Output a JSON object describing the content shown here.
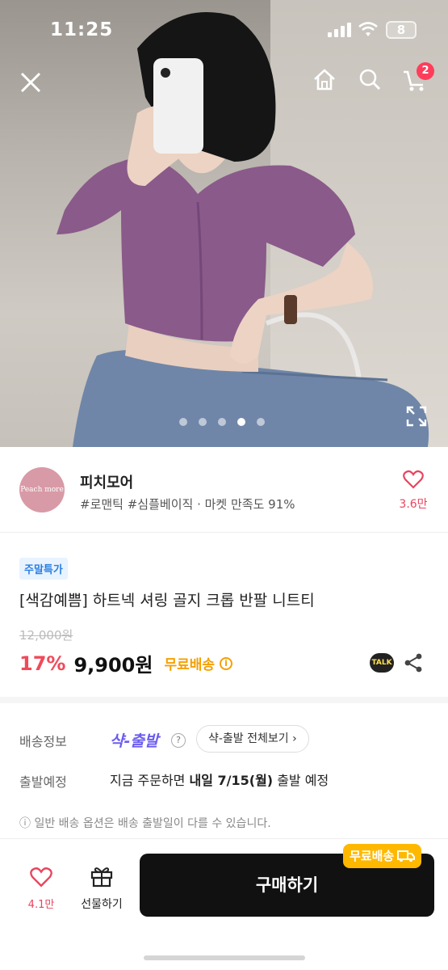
{
  "status": {
    "time": "11:25",
    "battery": "8"
  },
  "nav": {
    "cart_count": "2",
    "close_icon": "close-icon",
    "home_icon": "home-icon",
    "search_icon": "search-icon",
    "cart_icon": "cart-icon"
  },
  "carousel": {
    "total": 5,
    "active": 4
  },
  "shop": {
    "logo_text": "Peach more",
    "name": "피치모어",
    "tags": "#로맨틱 #심플베이직 · 마켓 만족도 91%",
    "likes": "3.6만"
  },
  "product": {
    "badge": "주말특가",
    "title": "[색감예쁨] 하트넥 셔링 골지 크롭 반팔 니트티",
    "original_price": "12,000원",
    "discount": "17%",
    "price": "9,900원",
    "free_shipping": "무료배송",
    "talk_label": "TALK"
  },
  "delivery": {
    "info_label": "배송정보",
    "shark_label": "샥-출발",
    "help_mark": "?",
    "see_all": "샥-출발 전체보기",
    "schedule_label": "출발예정",
    "schedule_pre": "지금 주문하면 ",
    "schedule_bold": "내일 7/15(월)",
    "schedule_post": " 출발 예정",
    "note": "ⓘ 일반 배송 옵션은 배송 출발일이 다를 수 있습니다."
  },
  "bottom": {
    "wish_count": "4.1만",
    "gift_label": "선물하기",
    "buy_label": "구매하기",
    "buy_badge": "무료배송"
  },
  "colors": {
    "accent_pink": "#e8455e",
    "discount_red": "#f04a5a",
    "ship_orange": "#f5a000",
    "shark_purple": "#6a5cf0"
  }
}
